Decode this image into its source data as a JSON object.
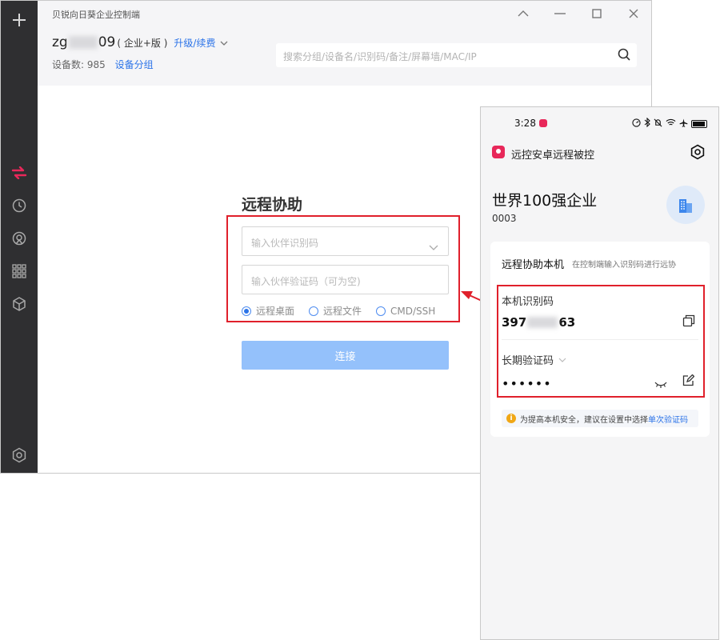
{
  "window": {
    "title": "贝锐向日葵企业控制端",
    "account": {
      "name_prefix": "zg",
      "name_suffix": "09",
      "edition": "( 企业+版 )",
      "upgrade": "升级/续费"
    },
    "devices_label": "设备数:",
    "devices_count": "985",
    "group_link": "设备分组",
    "search_placeholder": "搜索分组/设备名/识别码/备注/屏幕墙/MAC/IP"
  },
  "remote_assist": {
    "title": "远程协助",
    "partner_id_placeholder": "输入伙伴识别码",
    "partner_code_placeholder": "输入伙伴验证码（可为空)",
    "modes": [
      "远程桌面",
      "远程文件",
      "CMD/SSH"
    ],
    "selected_mode": "远程桌面",
    "connect_label": "连接"
  },
  "phone": {
    "time": "3:28",
    "app_title": "远控安卓远程被控",
    "org_name": "世界100强企业",
    "org_code": "0003",
    "card_title": "远程协助本机",
    "card_subtitle": "在控制端输入识别码进行远协",
    "id_label": "本机识别码",
    "id_prefix": "397",
    "id_suffix": "63",
    "code_label": "长期验证码",
    "code_mask": "••••••",
    "tip_text": "为提高本机安全，建议在设置中选择",
    "tip_link": "单次验证码"
  },
  "colors": {
    "accent": "#2b73e8",
    "highlight": "#e0202b",
    "brand": "#e8285a",
    "sidebar": "#2f2f31"
  }
}
